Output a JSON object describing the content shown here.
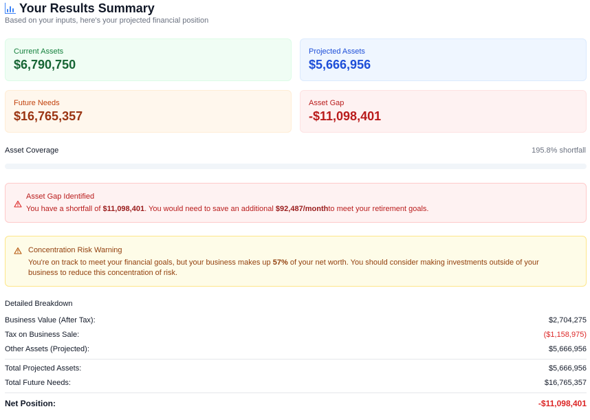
{
  "header": {
    "icon": "bar-chart-icon",
    "title": "Your Results Summary",
    "subtitle": "Based on your inputs, here's your projected financial position"
  },
  "cards": {
    "current_assets": {
      "label": "Current Assets",
      "value": "$6,790,750"
    },
    "projected_assets": {
      "label": "Projected Assets",
      "value": "$5,666,956"
    },
    "future_needs": {
      "label": "Future Needs",
      "value": "$16,765,357"
    },
    "asset_gap": {
      "label": "Asset Gap",
      "value": "-$11,098,401"
    }
  },
  "coverage": {
    "label": "Asset Coverage",
    "value_text": "195.8% shortfall",
    "fill_percent": 0
  },
  "alerts": {
    "gap": {
      "icon": "warning-triangle-icon",
      "title": "Asset Gap Identified",
      "pre": "You have a shortfall of ",
      "shortfall": "$11,098,401",
      "mid": ". You would need to save an additional ",
      "monthly": "$92,487/month",
      "post": "to meet your retirement goals."
    },
    "concentration": {
      "icon": "warning-triangle-icon",
      "title": "Concentration Risk Warning",
      "pre": "You're on track to meet your financial goals, but your business makes up ",
      "percent": "57%",
      "post": " of your net worth. You should consider making investments outside of your business to reduce this concentration of risk."
    }
  },
  "breakdown": {
    "title": "Detailed Breakdown",
    "rows": [
      {
        "label": "Business Value (After Tax):",
        "value": "$2,704,275"
      },
      {
        "label": "Tax on Business Sale:",
        "value": "($1,158,975)"
      },
      {
        "label": "Other Assets (Projected):",
        "value": "$5,666,956"
      },
      {
        "label": "Total Projected Assets:",
        "value": "$5,666,956"
      },
      {
        "label": "Total Future Needs:",
        "value": "$16,765,357"
      }
    ],
    "net": {
      "label": "Net Position:",
      "value": "-$11,098,401"
    }
  },
  "colors": {
    "accent": "#3b82f6",
    "negative": "#dc2626",
    "green": "#166534",
    "blue": "#1d4ed8",
    "orange": "#9a3412",
    "red": "#b91c1c"
  }
}
